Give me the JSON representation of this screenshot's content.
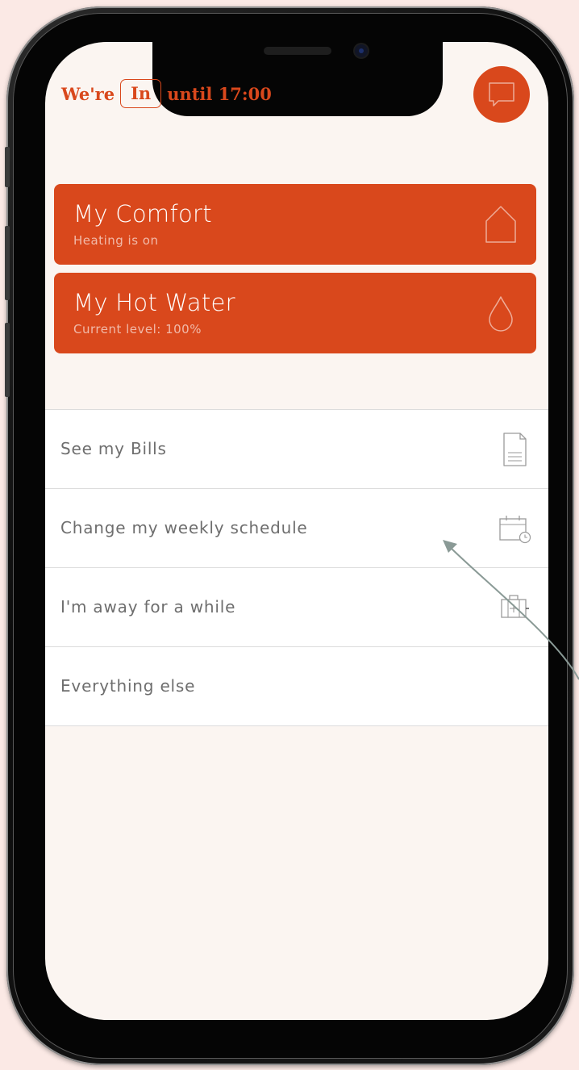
{
  "status": {
    "prefix": "We're",
    "state": "In",
    "suffix": "until 17:00"
  },
  "cards": [
    {
      "title": "My Comfort",
      "subtitle": "Heating is on",
      "icon": "house-icon"
    },
    {
      "title": "My Hot Water",
      "subtitle": "Current level: 100%",
      "icon": "water-drop-icon"
    }
  ],
  "menu": [
    {
      "label": "See my Bills",
      "icon": "document-icon"
    },
    {
      "label": "Change my weekly schedule",
      "icon": "calendar-clock-icon"
    },
    {
      "label": "I'm away for a while",
      "icon": "suitcase-icon"
    },
    {
      "label": "Everything else",
      "icon": ""
    }
  ],
  "colors": {
    "accent": "#d9481c",
    "background": "#fbf5f1",
    "page_background": "#fbe9e5",
    "menu_text": "#6e6e6e",
    "annotation_arrow": "#8a9a96"
  }
}
